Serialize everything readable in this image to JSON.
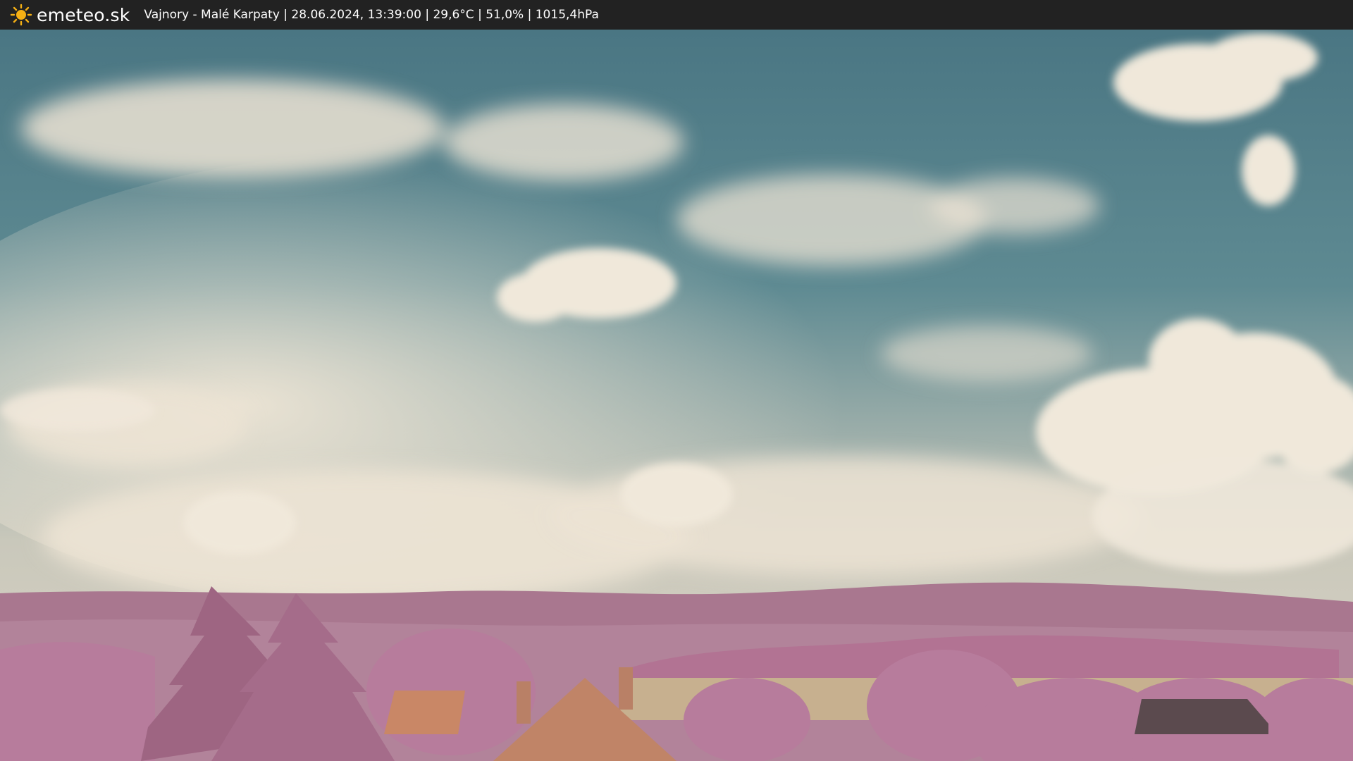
{
  "topbar": {
    "brand": "emeteo.sk",
    "logo_icon": "sun-icon",
    "logo_color": "#f5b014",
    "caption": "Vajnory - Malé Karpaty | 28.06.2024, 13:39:00 | 29,6°C | 51,0% | 1015,4hPa"
  },
  "colors": {
    "sky_top": "#3e6b78",
    "clouds": "#ece3d4",
    "hills": "#a9778f",
    "trees": "#b77c9c",
    "field": "#c7b08f",
    "roof": "#c98766"
  }
}
